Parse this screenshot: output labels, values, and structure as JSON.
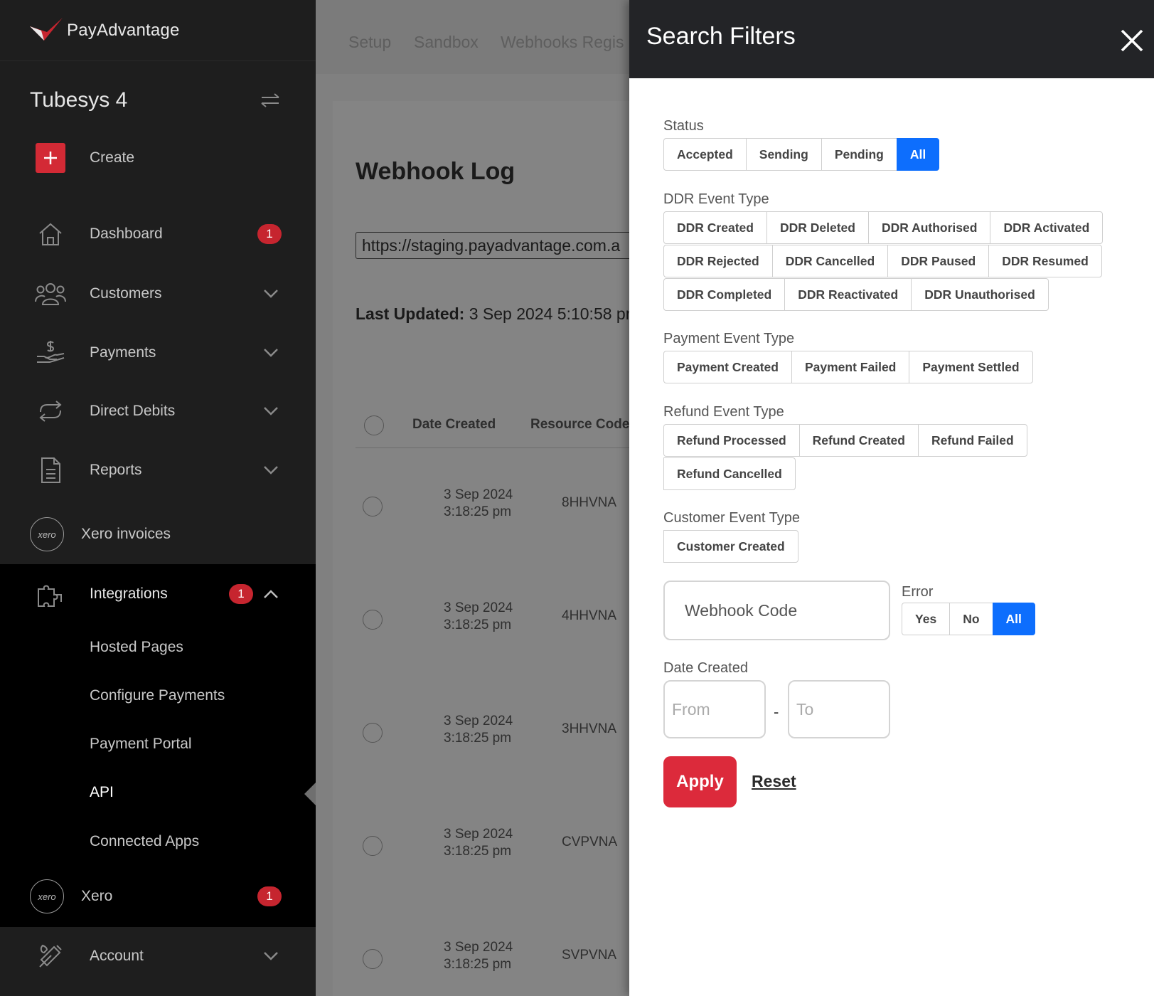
{
  "brand": {
    "name": "PayAdvantage",
    "accent": "#d32a35",
    "primary_blue": "#0d6efd"
  },
  "sidebar": {
    "org_name": "Tubesys 4",
    "create_label": "Create",
    "items": [
      {
        "label": "Dashboard",
        "icon": "home-icon",
        "badge": "1"
      },
      {
        "label": "Customers",
        "icon": "users-icon"
      },
      {
        "label": "Payments",
        "icon": "payment-hand-icon"
      },
      {
        "label": "Direct Debits",
        "icon": "repeat-icon"
      },
      {
        "label": "Reports",
        "icon": "document-icon"
      },
      {
        "label": "Xero invoices",
        "icon": "xero-icon",
        "icon_text": "xero"
      },
      {
        "label": "Integrations",
        "icon": "puzzle-icon",
        "badge": "1"
      }
    ],
    "integrations_sub": [
      "Hosted Pages",
      "Configure Payments",
      "Payment Portal",
      "API",
      "Connected Apps"
    ],
    "xero": {
      "label": "Xero",
      "badge": "1",
      "icon_text": "xero"
    },
    "account": {
      "label": "Account",
      "icon": "tools-icon"
    }
  },
  "main": {
    "tabs": [
      "Setup",
      "Sandbox",
      "Webhooks Regis"
    ],
    "title": "Webhook Log",
    "url": "https://staging.payadvantage.com.a",
    "last_updated_label": "Last Updated:",
    "last_updated_value": " 3 Sep 2024 5:10:58 pr",
    "columns": [
      "Date Created",
      "Resource Code"
    ],
    "rows": [
      {
        "date": "3 Sep 2024",
        "time": "3:18:25 pm",
        "code": "8HHVNA"
      },
      {
        "date": "3 Sep 2024",
        "time": "3:18:25 pm",
        "code": "4HHVNA"
      },
      {
        "date": "3 Sep 2024",
        "time": "3:18:25 pm",
        "code": "3HHVNA"
      },
      {
        "date": "3 Sep 2024",
        "time": "3:18:25 pm",
        "code": "CVPVNA"
      },
      {
        "date": "3 Sep 2024",
        "time": "3:18:25 pm",
        "code": "SVPVNA"
      }
    ]
  },
  "filters": {
    "title": "Search Filters",
    "status": {
      "label": "Status",
      "options": [
        "Accepted",
        "Sending",
        "Pending",
        "All"
      ],
      "selected": "All"
    },
    "ddr": {
      "label": "DDR Event Type",
      "rows": [
        [
          "DDR Created",
          "DDR Deleted",
          "DDR Authorised",
          "DDR Activated"
        ],
        [
          "DDR Rejected",
          "DDR Cancelled",
          "DDR Paused",
          "DDR Resumed"
        ],
        [
          "DDR Completed",
          "DDR Reactivated",
          "DDR Unauthorised"
        ]
      ]
    },
    "payment": {
      "label": "Payment Event Type",
      "options": [
        "Payment Created",
        "Payment Failed",
        "Payment Settled"
      ]
    },
    "refund": {
      "label": "Refund Event Type",
      "rows": [
        [
          "Refund Processed",
          "Refund Created",
          "Refund Failed"
        ],
        [
          "Refund Cancelled"
        ]
      ]
    },
    "customer": {
      "label": "Customer Event Type",
      "options": [
        "Customer Created"
      ]
    },
    "webhook_code_placeholder": "Webhook Code",
    "error": {
      "label": "Error",
      "options": [
        "Yes",
        "No",
        "All"
      ],
      "selected": "All"
    },
    "date_created": {
      "label": "Date Created",
      "from_placeholder": "From",
      "to_placeholder": "To",
      "separator": "-"
    },
    "apply_label": "Apply",
    "reset_label": "Reset"
  }
}
